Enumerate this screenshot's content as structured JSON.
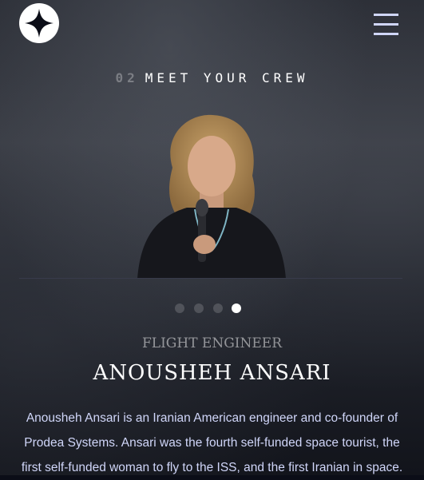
{
  "header": {
    "logo_icon": "star-logo-icon",
    "menu_icon": "hamburger-menu-icon"
  },
  "section": {
    "number": "02",
    "title": "MEET YOUR CREW"
  },
  "crew": {
    "dots": [
      {
        "label": "crew-member-1",
        "active": false
      },
      {
        "label": "crew-member-2",
        "active": false
      },
      {
        "label": "crew-member-3",
        "active": false
      },
      {
        "label": "crew-member-4",
        "active": true
      }
    ],
    "role": "Flight Engineer",
    "name": "Anousheh Ansari",
    "bio": "Anousheh Ansari is an Iranian American engineer and co-founder of Prodea Systems. Ansari was the fourth self-funded space tourist, the first self-funded woman to fly to the ISS, and the first Iranian in space."
  },
  "colors": {
    "accent": "#d0d6f9",
    "background": "#0b0d17",
    "white": "#ffffff"
  }
}
